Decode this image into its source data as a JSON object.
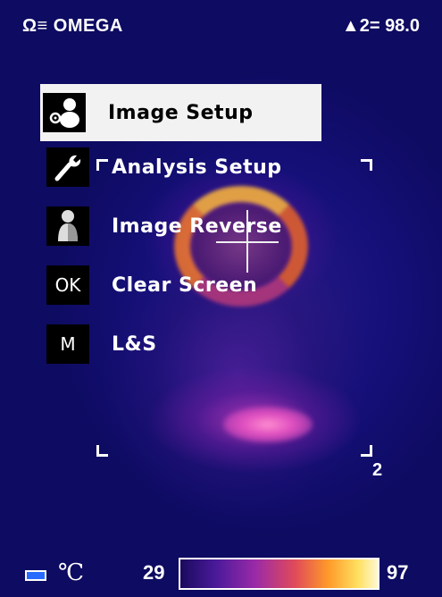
{
  "header": {
    "brand": "OMEGA",
    "brand_symbol": "Ω≡",
    "readout_marker": "▲",
    "readout": "2= 98.0"
  },
  "menu": {
    "items": [
      {
        "label": "Image Setup",
        "icon": "camera-person-icon",
        "selected": true
      },
      {
        "label": "Analysis Setup",
        "icon": "wrench-icon",
        "selected": false
      },
      {
        "label": "Image Reverse",
        "icon": "person-silhouette-icon",
        "selected": false
      },
      {
        "label": "Clear Screen",
        "icon_text": "OK",
        "selected": false
      },
      {
        "label": "L&S",
        "icon_text": "M",
        "selected": false
      }
    ]
  },
  "measure_zone": {
    "number": "2"
  },
  "footer": {
    "unit": "℃",
    "scale_min": "29",
    "scale_max": "97"
  },
  "colors": {
    "background": "#0d0b5e",
    "selected_bg": "#f2f2f2",
    "battery": "#2a6bff"
  }
}
